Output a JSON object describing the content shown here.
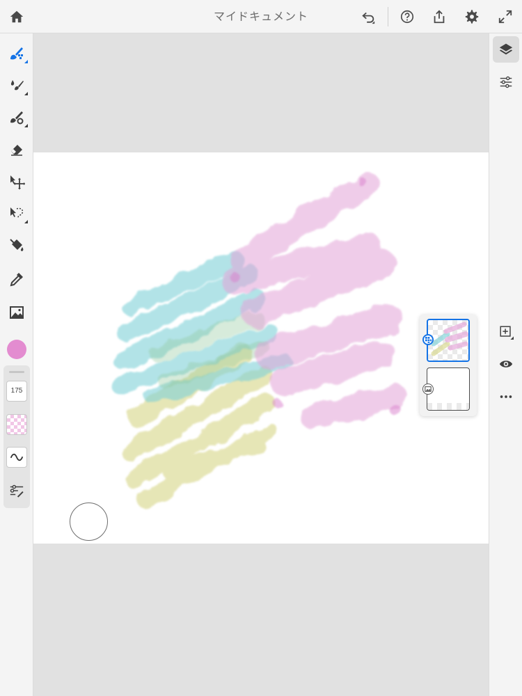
{
  "document": {
    "title": "マイドキュメント"
  },
  "topbar": {
    "icons": [
      "home-icon",
      "undo-icon",
      "help-icon",
      "share-icon",
      "settings-icon",
      "fullscreen-icon"
    ]
  },
  "left_toolbar": {
    "tools": [
      "pixel-brush-icon",
      "live-brush-icon",
      "vector-brush-icon",
      "eraser-icon",
      "transform-icon",
      "selection-icon",
      "fill-icon",
      "eyedropper-icon",
      "image-icon"
    ],
    "active_tool": "pixel-brush-icon",
    "current_color": "#e38cd0",
    "brush_size": "175"
  },
  "right_toolbar": {
    "icons": [
      "layers-icon",
      "layer-properties-icon",
      "add-layer-icon",
      "visibility-icon",
      "more-icon"
    ],
    "active": "layers-icon"
  },
  "layers": [
    {
      "type": "paint",
      "selected": true
    },
    {
      "type": "image",
      "selected": false
    }
  ],
  "colors": {
    "accent": "#1473e6",
    "pink": "#e38cd0",
    "teal": "#7fd1d8",
    "yellow": "#d8d78a"
  }
}
